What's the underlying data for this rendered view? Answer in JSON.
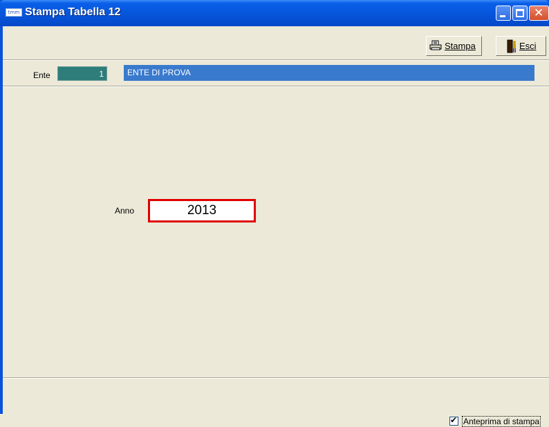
{
  "window": {
    "title": "Stampa Tabella 12",
    "icon_text": "tmm",
    "close_glyph": "✕",
    "minimize_icon": "minimize-icon",
    "maximize_icon": "maximize-icon",
    "close_icon": "close-icon"
  },
  "toolbar": {
    "print_label": "Stampa",
    "print_icon": "printer-icon",
    "exit_label": "Esci",
    "exit_icon": "exit-door-icon"
  },
  "ente": {
    "label": "Ente",
    "code": "1",
    "name": "ENTE DI PROVA"
  },
  "form": {
    "anno_label": "Anno",
    "anno_value": "2013"
  },
  "footer": {
    "preview_label": "Anteprima di stampa",
    "preview_checked": true,
    "check_glyph": "✔"
  },
  "colors": {
    "titlebar": "#0655DA",
    "ente_code_bg": "#2E7D7B",
    "ente_name_bg": "#3A7ACD",
    "highlight_border": "#E00000",
    "background": "#ECE9D8"
  }
}
